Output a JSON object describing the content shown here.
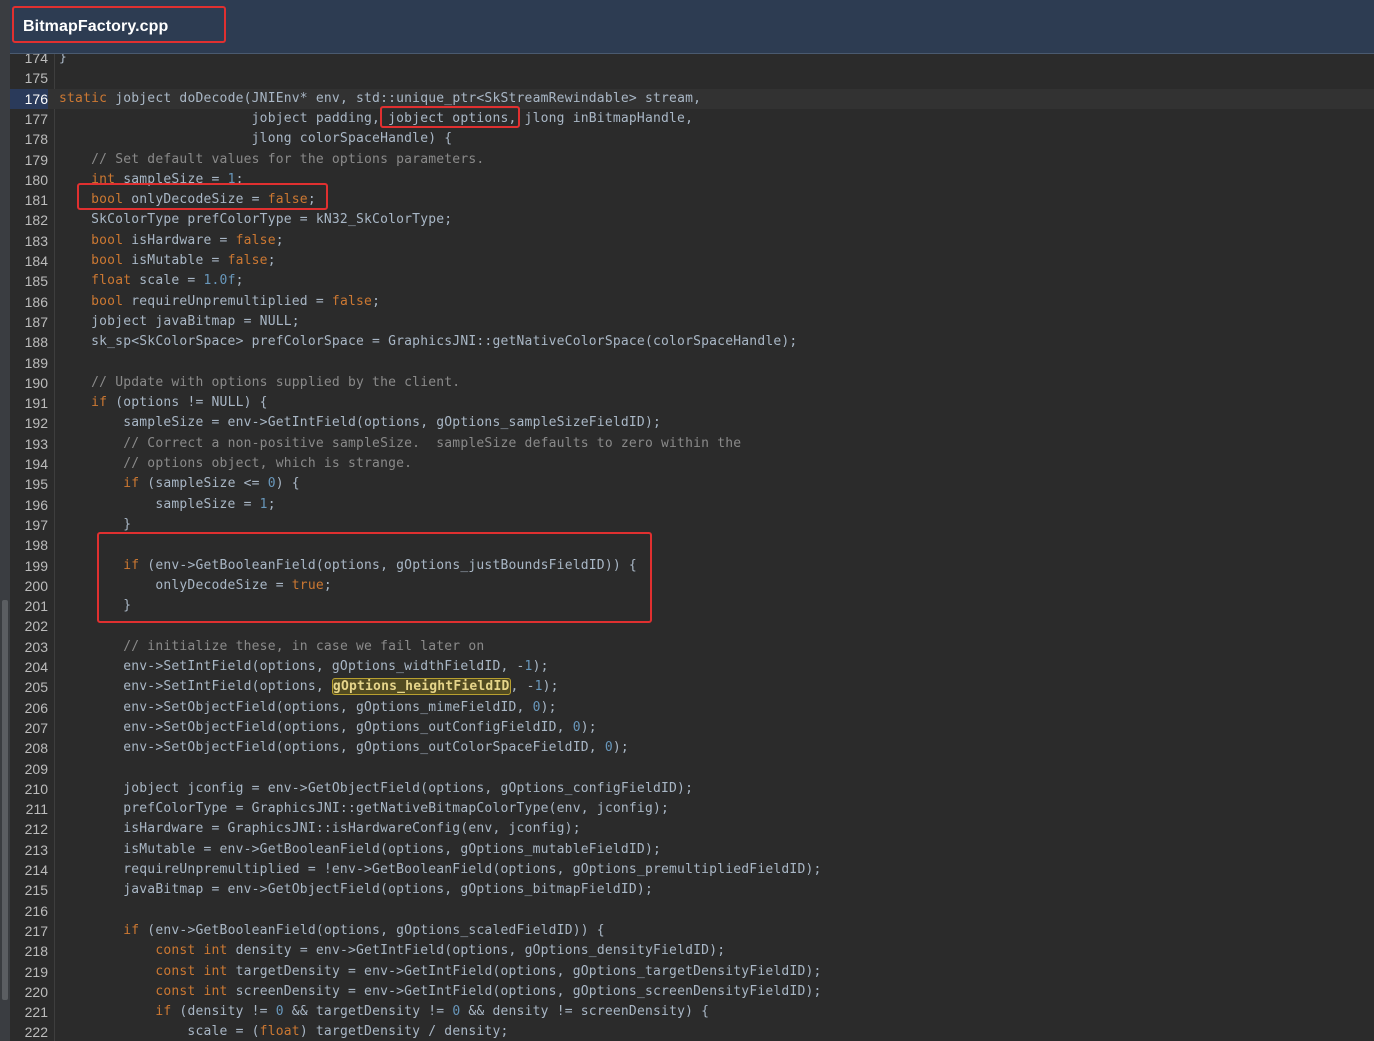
{
  "tab": {
    "filename": "BitmapFactory.cpp"
  },
  "editor": {
    "current_line": 176,
    "highlighted_word": "gOptions_heightFieldID",
    "lines": [
      {
        "n": "174",
        "t": "}"
      },
      {
        "n": "175",
        "t": ""
      },
      {
        "n": "176",
        "t": "static jobject doDecode(JNIEnv* env, std::unique_ptr<SkStreamRewindable> stream,"
      },
      {
        "n": "177",
        "t": "                        jobject padding, jobject options, jlong inBitmapHandle,"
      },
      {
        "n": "178",
        "t": "                        jlong colorSpaceHandle) {"
      },
      {
        "n": "179",
        "t": "    // Set default values for the options parameters."
      },
      {
        "n": "180",
        "t": "    int sampleSize = 1;"
      },
      {
        "n": "181",
        "t": "    bool onlyDecodeSize = false;"
      },
      {
        "n": "182",
        "t": "    SkColorType prefColorType = kN32_SkColorType;"
      },
      {
        "n": "183",
        "t": "    bool isHardware = false;"
      },
      {
        "n": "184",
        "t": "    bool isMutable = false;"
      },
      {
        "n": "185",
        "t": "    float scale = 1.0f;"
      },
      {
        "n": "186",
        "t": "    bool requireUnpremultiplied = false;"
      },
      {
        "n": "187",
        "t": "    jobject javaBitmap = NULL;"
      },
      {
        "n": "188",
        "t": "    sk_sp<SkColorSpace> prefColorSpace = GraphicsJNI::getNativeColorSpace(colorSpaceHandle);"
      },
      {
        "n": "189",
        "t": ""
      },
      {
        "n": "190",
        "t": "    // Update with options supplied by the client."
      },
      {
        "n": "191",
        "t": "    if (options != NULL) {"
      },
      {
        "n": "192",
        "t": "        sampleSize = env->GetIntField(options, gOptions_sampleSizeFieldID);"
      },
      {
        "n": "193",
        "t": "        // Correct a non-positive sampleSize.  sampleSize defaults to zero within the"
      },
      {
        "n": "194",
        "t": "        // options object, which is strange."
      },
      {
        "n": "195",
        "t": "        if (sampleSize <= 0) {"
      },
      {
        "n": "196",
        "t": "            sampleSize = 1;"
      },
      {
        "n": "197",
        "t": "        }"
      },
      {
        "n": "198",
        "t": ""
      },
      {
        "n": "199",
        "t": "        if (env->GetBooleanField(options, gOptions_justBoundsFieldID)) {"
      },
      {
        "n": "200",
        "t": "            onlyDecodeSize = true;"
      },
      {
        "n": "201",
        "t": "        }"
      },
      {
        "n": "202",
        "t": ""
      },
      {
        "n": "203",
        "t": "        // initialize these, in case we fail later on"
      },
      {
        "n": "204",
        "t": "        env->SetIntField(options, gOptions_widthFieldID, -1);"
      },
      {
        "n": "205",
        "t": "        env->SetIntField(options, gOptions_heightFieldID, -1);"
      },
      {
        "n": "206",
        "t": "        env->SetObjectField(options, gOptions_mimeFieldID, 0);"
      },
      {
        "n": "207",
        "t": "        env->SetObjectField(options, gOptions_outConfigFieldID, 0);"
      },
      {
        "n": "208",
        "t": "        env->SetObjectField(options, gOptions_outColorSpaceFieldID, 0);"
      },
      {
        "n": "209",
        "t": ""
      },
      {
        "n": "210",
        "t": "        jobject jconfig = env->GetObjectField(options, gOptions_configFieldID);"
      },
      {
        "n": "211",
        "t": "        prefColorType = GraphicsJNI::getNativeBitmapColorType(env, jconfig);"
      },
      {
        "n": "212",
        "t": "        isHardware = GraphicsJNI::isHardwareConfig(env, jconfig);"
      },
      {
        "n": "213",
        "t": "        isMutable = env->GetBooleanField(options, gOptions_mutableFieldID);"
      },
      {
        "n": "214",
        "t": "        requireUnpremultiplied = !env->GetBooleanField(options, gOptions_premultipliedFieldID);"
      },
      {
        "n": "215",
        "t": "        javaBitmap = env->GetObjectField(options, gOptions_bitmapFieldID);"
      },
      {
        "n": "216",
        "t": ""
      },
      {
        "n": "217",
        "t": "        if (env->GetBooleanField(options, gOptions_scaledFieldID)) {"
      },
      {
        "n": "218",
        "t": "            const int density = env->GetIntField(options, gOptions_densityFieldID);"
      },
      {
        "n": "219",
        "t": "            const int targetDensity = env->GetIntField(options, gOptions_targetDensityFieldID);"
      },
      {
        "n": "220",
        "t": "            const int screenDensity = env->GetIntField(options, gOptions_screenDensityFieldID);"
      },
      {
        "n": "221",
        "t": "            if (density != 0 && targetDensity != 0 && density != screenDensity) {"
      },
      {
        "n": "222",
        "t": "                scale = (float) targetDensity / density;"
      }
    ]
  }
}
